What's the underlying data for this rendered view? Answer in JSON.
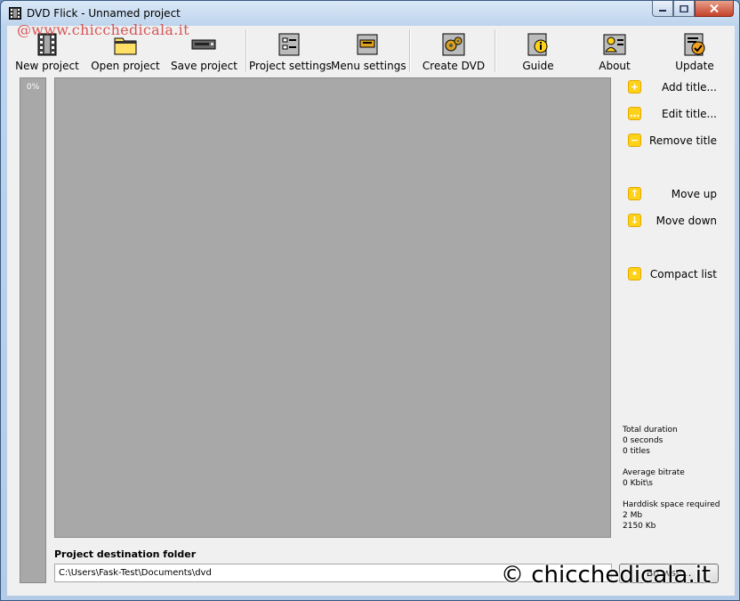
{
  "window": {
    "title": "DVD Flick - Unnamed project"
  },
  "watermarks": {
    "top": "@www.chicchedicala.it",
    "bottom": "© chicchedicala.it"
  },
  "toolbar": {
    "new_project": "New project",
    "open_project": "Open project",
    "save_project": "Save project",
    "project_settings": "Project settings",
    "menu_settings": "Menu settings",
    "create_dvd": "Create DVD",
    "guide": "Guide",
    "about": "About",
    "update": "Update"
  },
  "progress": {
    "text": "0%"
  },
  "side": {
    "add_title": "Add title...",
    "edit_title": "Edit title...",
    "remove_title": "Remove title",
    "move_up": "Move up",
    "move_down": "Move down",
    "compact_list": "Compact list"
  },
  "stats": {
    "duration_label": "Total duration",
    "duration_seconds": "0 seconds",
    "duration_titles": "0 titles",
    "bitrate_label": "Average bitrate",
    "bitrate_value": "0 Kbit\\s",
    "space_label": "Harddisk space required",
    "space_mb": "2 Mb",
    "space_kb": "2150 Kb"
  },
  "destination": {
    "label": "Project destination folder",
    "value": "C:\\Users\\Fask-Test\\Documents\\dvd",
    "browse": "Browse..."
  },
  "colors": {
    "accent_yellow": "#ffd21a",
    "list_gray": "#a8a8a8",
    "watermark_red": "#d43a3a"
  }
}
